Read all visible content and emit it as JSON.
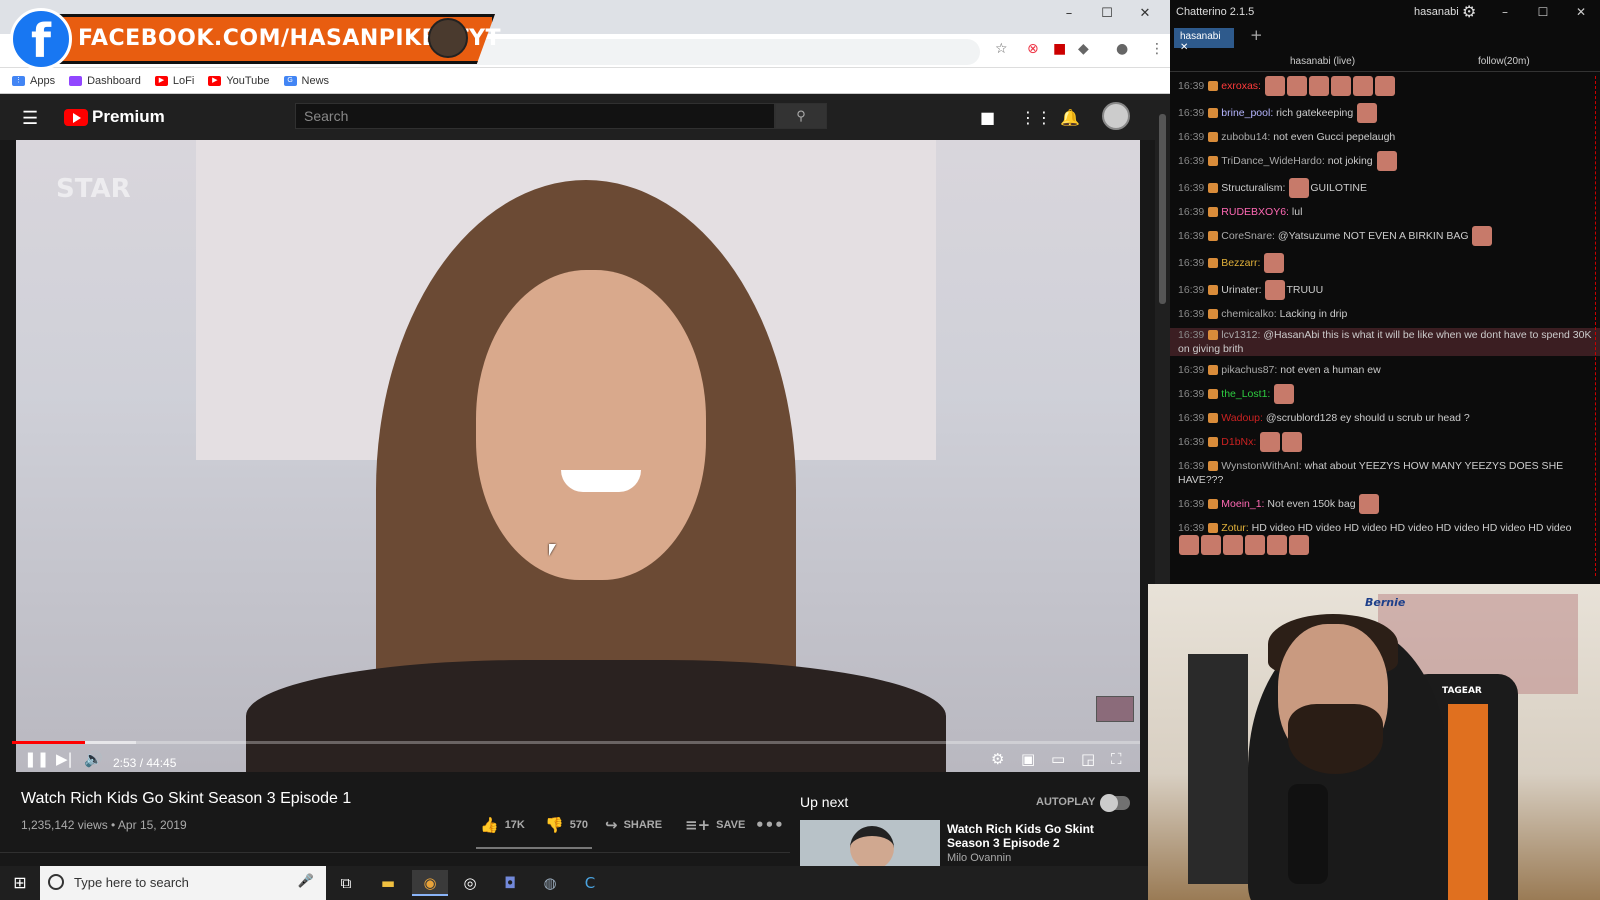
{
  "banner": {
    "text": "FACEBOOK.COM/HASANPIKERTYT"
  },
  "browser": {
    "bookmarks": [
      {
        "label": "Apps",
        "color": "#4285f4"
      },
      {
        "label": "Dashboard",
        "color": "#9146ff"
      },
      {
        "label": "LoFi",
        "color": "#ff0000"
      },
      {
        "label": "YouTube",
        "color": "#ff0000"
      },
      {
        "label": "News",
        "color": "#4285f4"
      }
    ],
    "controls": {
      "minimize": "–",
      "maximize": "☐",
      "close": "✕"
    }
  },
  "youtube": {
    "logo": "Premium",
    "search_placeholder": "Search",
    "video": {
      "watermark": "STAR",
      "current_time": "2:53",
      "duration": "44:45",
      "time_display": "2:53 / 44:45",
      "progress": 0.0646,
      "buffered": 0.11,
      "title": "Watch Rich Kids Go Skint Season 3 Episode 1",
      "views": "1,235,142 views",
      "date": "Apr 15, 2019",
      "meta": "1,235,142 views • Apr 15, 2019",
      "likes": "17K",
      "dislikes": "570",
      "share": "SHARE",
      "save": "SAVE"
    },
    "up_next": {
      "label": "Up next",
      "autoplay": "AUTOPLAY",
      "title": "Watch Rich Kids Go Skint Season 3 Episode 2",
      "channel": "Milo Ovannin"
    }
  },
  "chatterino": {
    "title": "Chatterino 2.1.5",
    "user": "hasanabi",
    "tab": "hasanabi",
    "channel": "hasanabi (live)",
    "follow_mode": "follow(20m)",
    "messages": [
      {
        "time": "16:39",
        "user": "exroxas:",
        "color": "#ff3b3b",
        "text": "",
        "emotes": 6
      },
      {
        "time": "16:39",
        "user": "brine_pool:",
        "color": "#b6b6ff",
        "text": "rich gatekeeping",
        "emotes": 1
      },
      {
        "time": "16:39",
        "user": "zubobu14:",
        "color": "#aaaaaa",
        "text": "not even Gucci pepelaugh",
        "emotes": 0
      },
      {
        "time": "16:39",
        "user": "TriDance_WideHardo:",
        "color": "#aaaaaa",
        "text": "not joking",
        "emotes": 1
      },
      {
        "time": "16:39",
        "user": "Structuralism:",
        "color": "#cccccc",
        "text": "GUILOTINE",
        "emotes": 1,
        "emote_first": true
      },
      {
        "time": "16:39",
        "user": "RUDEBXOY6:",
        "color": "#ff69b4",
        "text": "lul",
        "emotes": 0
      },
      {
        "time": "16:39",
        "user": "CoreSnare:",
        "color": "#aaaaaa",
        "text": "@Yatsuzume NOT EVEN A BIRKIN BAG",
        "emotes": 1
      },
      {
        "time": "16:39",
        "user": "Bezzarr:",
        "color": "#e0b03a",
        "text": "",
        "emotes": 1
      },
      {
        "time": "16:39",
        "user": "Urinater:",
        "color": "#cccccc",
        "text": "TRUUU",
        "emotes": 1,
        "emote_first": true
      },
      {
        "time": "16:39",
        "user": "chemicalko:",
        "color": "#aaaaaa",
        "text": "Lacking in drip",
        "emotes": 0
      },
      {
        "time": "16:39",
        "user": "lcv1312:",
        "color": "#aaaaaa",
        "text": "@HasanAbi this is what it will be like when we dont have to spend 30K on giving brith",
        "emotes": 0,
        "highlight": true
      },
      {
        "time": "16:39",
        "user": "pikachus87:",
        "color": "#aaaaaa",
        "text": "not even a human ew",
        "emotes": 0
      },
      {
        "time": "16:39",
        "user": "the_Lost1:",
        "color": "#2ecc40",
        "text": "",
        "emotes": 1
      },
      {
        "time": "16:39",
        "user": "Wadoup:",
        "color": "#cc2222",
        "text": "@scrublord128 ey should u scrub ur head ?",
        "emotes": 0
      },
      {
        "time": "16:39",
        "user": "D1bNx:",
        "color": "#cc2222",
        "text": "",
        "emotes": 2
      },
      {
        "time": "16:39",
        "user": "WynstonWithAnI:",
        "color": "#aaaaaa",
        "text": "what about YEEZYS HOW MANY YEEZYS DOES SHE HAVE???",
        "emotes": 0
      },
      {
        "time": "16:39",
        "user": "Moein_1:",
        "color": "#ff69b4",
        "text": "Not even 150k bag",
        "emotes": 1
      },
      {
        "time": "16:39",
        "user": "Zotur:",
        "color": "#e0b03a",
        "text": "HD video HD video HD video HD video HD video HD video HD video",
        "emotes": 6
      }
    ]
  },
  "webcam": {
    "poster_text": "Bernie",
    "chair_brand": "TAGEAR"
  },
  "taskbar": {
    "search_placeholder": "Type here to search"
  }
}
